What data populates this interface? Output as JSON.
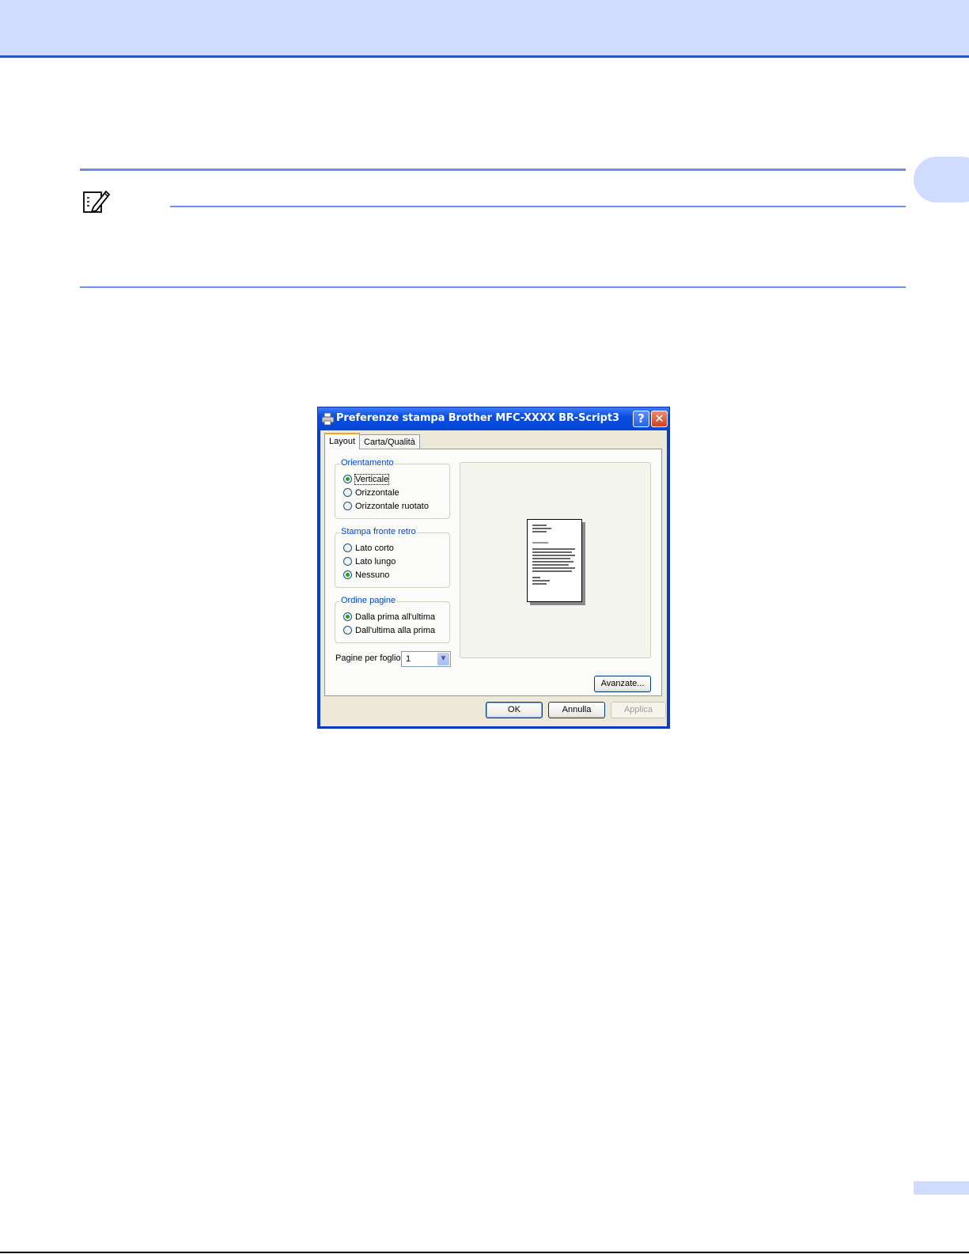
{
  "dialog": {
    "title": "Preferenze stampa Brother MFC-XXXX BR-Script3",
    "help_glyph": "?",
    "close_glyph": "✕",
    "tabs": [
      {
        "label": "Layout",
        "active": true
      },
      {
        "label": "Carta/Qualità",
        "active": false
      }
    ],
    "orientation": {
      "label": "Orientamento",
      "options": [
        "Verticale",
        "Orizzontale",
        "Orizzontale ruotato"
      ],
      "selected": "Verticale"
    },
    "duplex": {
      "label": "Stampa fronte retro",
      "options": [
        "Lato corto",
        "Lato lungo",
        "Nessuno"
      ],
      "selected": "Nessuno"
    },
    "page_order": {
      "label": "Ordine pagine",
      "options": [
        "Dalla prima all'ultima",
        "Dall'ultima alla prima"
      ],
      "selected": "Dalla prima all'ultima"
    },
    "pages_per_sheet": {
      "label": "Pagine per foglio:",
      "value": "1"
    },
    "buttons": {
      "advanced": "Avanzate...",
      "ok": "OK",
      "cancel": "Annulla",
      "apply": "Applica"
    }
  },
  "colors": {
    "header_band": "#cfdcff",
    "header_border": "#2a52be",
    "rule": "#6d8fea",
    "titlebar": "#0a4ee0",
    "group_label": "#0046d5"
  }
}
